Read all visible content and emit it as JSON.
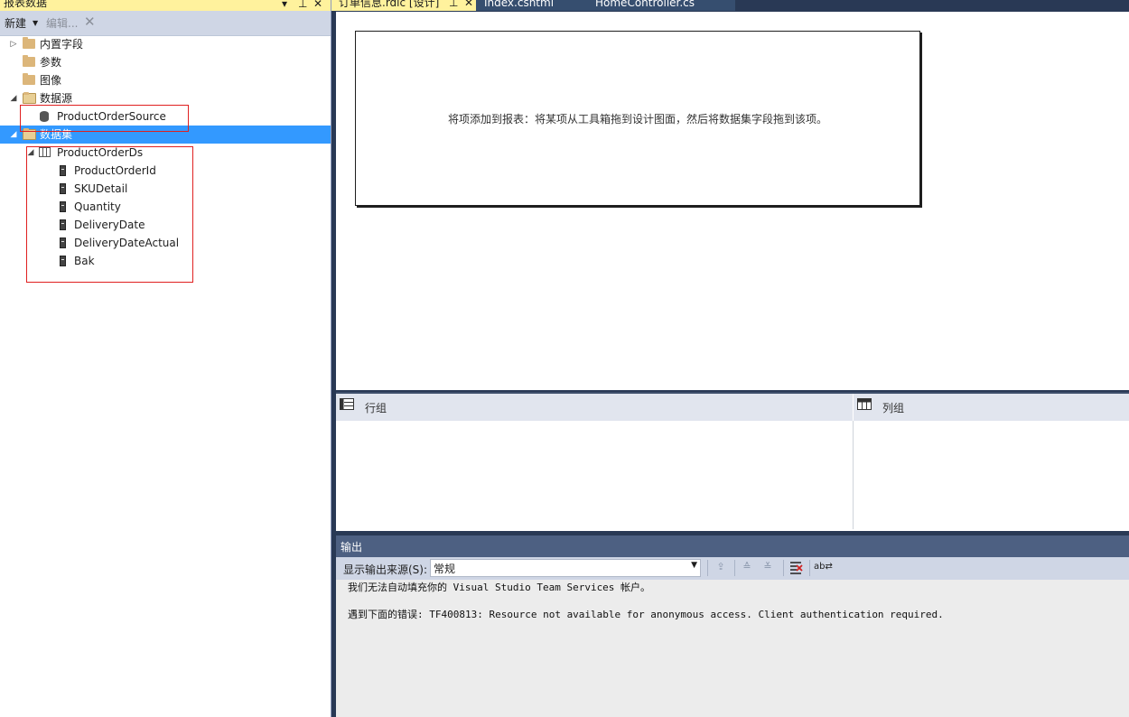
{
  "left_panel": {
    "title": "报表数据",
    "toolbar": {
      "new_label": "新建",
      "edit_label": "编辑..."
    },
    "tree": {
      "builtin_fields": "内置字段",
      "parameters": "参数",
      "images": "图像",
      "data_sources": "数据源",
      "data_source_item": "ProductOrderSource",
      "datasets": "数据集",
      "dataset_item": "ProductOrderDs",
      "fields": [
        "ProductOrderId",
        "SKUDetail",
        "Quantity",
        "DeliveryDate",
        "DeliveryDateActual",
        "Bak"
      ]
    }
  },
  "tabs": [
    {
      "label": "订单信息.rdlc [设计]",
      "active": true
    },
    {
      "label": "Index.cshtml",
      "active": false
    },
    {
      "label": "HomeController.cs",
      "active": false
    }
  ],
  "designer": {
    "placeholder": "将项添加到报表：将某项从工具箱拖到设计图面，然后将数据集字段拖到该项。"
  },
  "grouping": {
    "row_groups": "行组",
    "column_groups": "列组"
  },
  "output": {
    "title": "输出",
    "source_label": "显示输出来源(S):",
    "source_value": "常规",
    "lines": [
      "我们无法自动填充你的 Visual Studio Team Services 帐户。",
      "遇到下面的错误: TF400813: Resource not available for anonymous access. Client authentication required."
    ]
  },
  "colors": {
    "selection": "#3399ff",
    "highlight_box": "#e02020",
    "title_yellow": "#fff29d",
    "output_title": "#4d6082"
  }
}
